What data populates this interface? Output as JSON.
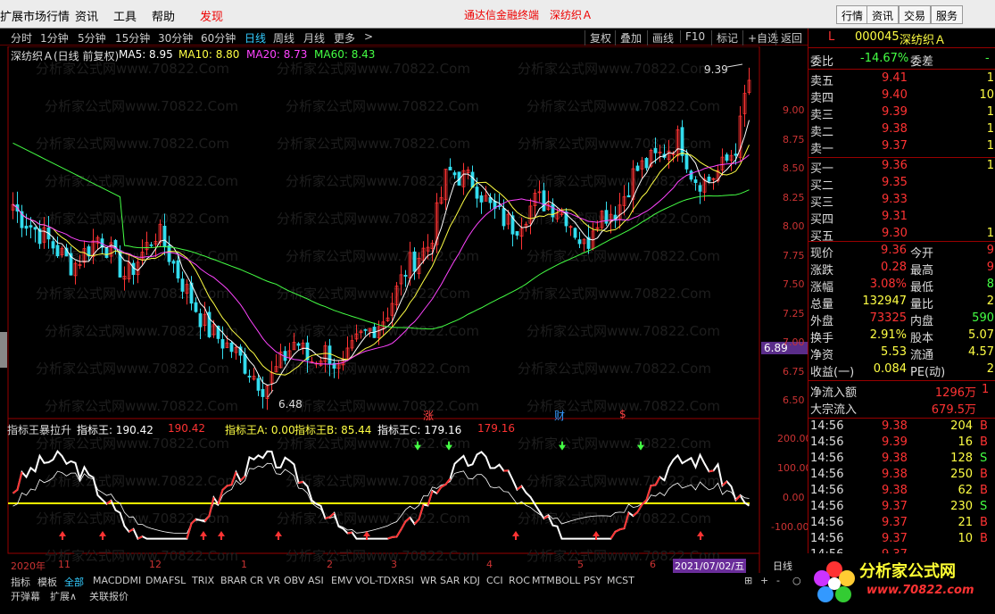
{
  "menubar": {
    "items": [
      "扩展市场行情",
      "资讯",
      "工具",
      "帮助"
    ],
    "discover": "发现",
    "banner_left": "通达信金融终端",
    "banner_right": "深纺织Ａ",
    "right_buttons": [
      "行情",
      "资讯",
      "交易",
      "服务"
    ]
  },
  "toolbar": {
    "periods": [
      "分时",
      "1分钟",
      "5分钟",
      "15分钟",
      "30分钟",
      "60分钟",
      "日线",
      "周线",
      "月线",
      "更多"
    ],
    "more_arrow": ">",
    "active": "日线",
    "right": [
      "复权",
      "叠加",
      "画线",
      "F10",
      "标记",
      "+自选",
      "返回"
    ]
  },
  "header": {
    "title": "深纺织Ａ(日线 前复权)",
    "ma5": "MA5: 8.95",
    "ma10": "MA10: 8.80",
    "ma20": "MA20: 8.73",
    "ma60": "MA60: 8.43"
  },
  "watermark": "分析家公式网www.70822.Com",
  "price_axis": [
    "9.00",
    "8.75",
    "8.50",
    "8.25",
    "8.00",
    "7.75",
    "7.50",
    "7.25",
    "7.00",
    "6.75",
    "6.50"
  ],
  "price_tag": "6.89",
  "annotations": {
    "high": "9.39",
    "low": "6.48",
    "zhang": "涨",
    "cai": "财",
    "s": "$"
  },
  "indicator": {
    "name": "指标王暴拉升",
    "label1": "指标王: 190.42",
    "v1": "190.42",
    "labela": "指标王A: 0.00",
    "labelb": "指标王B: 85.44",
    "labelc": "指标王C: 179.16",
    "vc": "179.16",
    "axis": [
      "200.00",
      "100.00",
      "0.00",
      "-100.00"
    ]
  },
  "date_axis": {
    "labels": [
      "2020年",
      "11",
      "12",
      "1",
      "2",
      "3",
      "4",
      "5",
      "6"
    ],
    "current": "2021/07/02/五",
    "period": "日线"
  },
  "bottom": {
    "tabs": [
      "指标",
      "模板",
      "全部",
      "MACD",
      "DMI",
      "DMA",
      "FSL",
      "TRIX",
      "BRAR",
      "CR",
      "VR",
      "OBV",
      "ASI",
      "EMV",
      "VOL-TDX",
      "RSI",
      "WR",
      "SAR",
      "KDJ",
      "CCI",
      "ROC",
      "MTM",
      "BOLL",
      "PSY",
      "MCST"
    ],
    "row2": [
      "开弹幕",
      "扩展∧",
      "关联报价"
    ],
    "controls": [
      "⊞",
      "+",
      "-",
      "○"
    ]
  },
  "side": {
    "code": "000045",
    "name": "深纺织Ａ",
    "l": "L",
    "weibi": {
      "label": "委比",
      "value": "-14.67%",
      "label2": "委差",
      "value2": "-"
    },
    "asks": [
      {
        "label": "卖五",
        "price": "9.41",
        "vol": "1"
      },
      {
        "label": "卖四",
        "price": "9.40",
        "vol": "10"
      },
      {
        "label": "卖三",
        "price": "9.39",
        "vol": "1"
      },
      {
        "label": "卖二",
        "price": "9.38",
        "vol": "1"
      },
      {
        "label": "卖一",
        "price": "9.37",
        "vol": "1"
      }
    ],
    "bids": [
      {
        "label": "买一",
        "price": "9.36",
        "vol": "1"
      },
      {
        "label": "买二",
        "price": "9.35",
        "vol": ""
      },
      {
        "label": "买三",
        "price": "9.33",
        "vol": ""
      },
      {
        "label": "买四",
        "price": "9.31",
        "vol": ""
      },
      {
        "label": "买五",
        "price": "9.30",
        "vol": "1"
      }
    ],
    "stats": [
      {
        "l1": "现价",
        "v1": "9.36",
        "l2": "今开",
        "v2": "9"
      },
      {
        "l1": "涨跌",
        "v1": "0.28",
        "l2": "最高",
        "v2": "9"
      },
      {
        "l1": "涨幅",
        "v1": "3.08%",
        "l2": "最低",
        "v2": "8"
      },
      {
        "l1": "总量",
        "v1": "132947",
        "l2": "量比",
        "v2": "2"
      },
      {
        "l1": "外盘",
        "v1": "73325",
        "l2": "内盘",
        "v2": "590"
      },
      {
        "l1": "换手",
        "v1": "2.91%",
        "l2": "股本",
        "v2": "5.07"
      },
      {
        "l1": "净资",
        "v1": "5.53",
        "l2": "流通",
        "v2": "4.57"
      },
      {
        "l1": "收益(一)",
        "v1": "0.084",
        "l2": "PE(动)",
        "v2": "2"
      }
    ],
    "flows": [
      {
        "label": "净流入额",
        "value": "1296万",
        "extra": "1"
      },
      {
        "label": "大宗流入",
        "value": "679.5万",
        "extra": ""
      }
    ],
    "ticks": [
      {
        "t": "14:56",
        "p": "9.38",
        "v": "204",
        "d": "B"
      },
      {
        "t": "14:56",
        "p": "9.39",
        "v": "16",
        "d": "B"
      },
      {
        "t": "14:56",
        "p": "9.38",
        "v": "128",
        "d": "S"
      },
      {
        "t": "14:56",
        "p": "9.38",
        "v": "250",
        "d": "B"
      },
      {
        "t": "14:56",
        "p": "9.38",
        "v": "62",
        "d": "B"
      },
      {
        "t": "14:56",
        "p": "9.37",
        "v": "230",
        "d": "S"
      },
      {
        "t": "14:56",
        "p": "9.37",
        "v": "21",
        "d": "B"
      },
      {
        "t": "14:56",
        "p": "9.37",
        "v": "10",
        "d": "B"
      },
      {
        "t": "14:56",
        "p": "9.37",
        "v": "",
        "d": ""
      }
    ],
    "logo": "分析家公式网",
    "logo_url": "www.70822.com"
  },
  "colors": {
    "up": "#ff3333",
    "down": "#33ddee",
    "ma5": "#ffffff",
    "ma10": "#ffff44",
    "ma20": "#ff44ff",
    "ma60": "#44ff44",
    "yellow": "#ffff00"
  }
}
